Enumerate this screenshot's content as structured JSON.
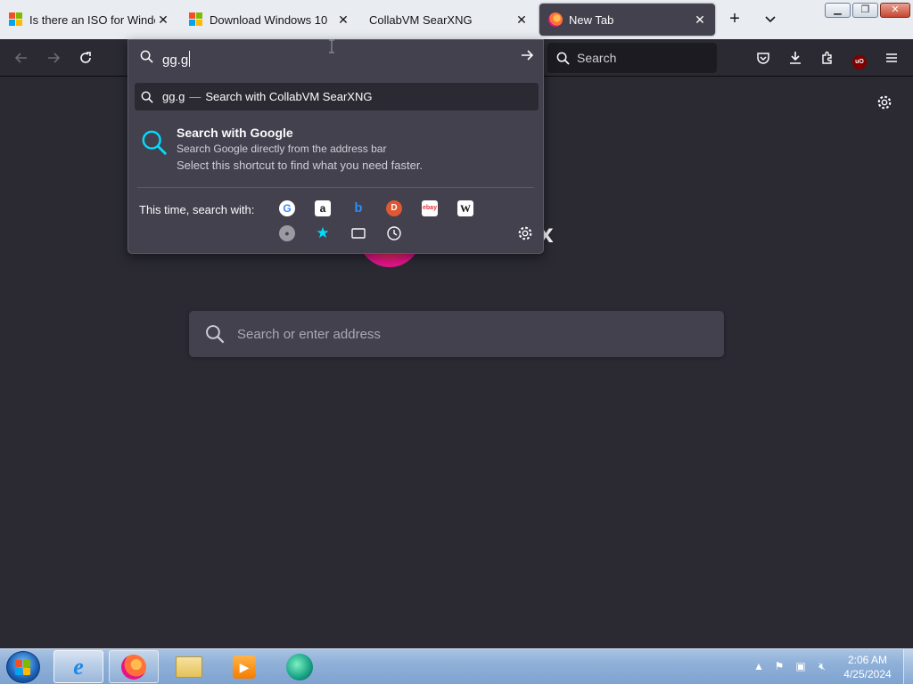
{
  "tabs": [
    {
      "title": "Is there an ISO for Windows",
      "icon": "windows-logo-icon",
      "active": false
    },
    {
      "title": "Download Windows 10",
      "icon": "windows-logo-icon",
      "active": false
    },
    {
      "title": "CollabVM SearXNG",
      "icon": "",
      "active": false
    },
    {
      "title": "New Tab",
      "icon": "firefox-logo-icon",
      "active": true
    }
  ],
  "toolbar": {
    "search_placeholder": "Search"
  },
  "urlbar": {
    "value": "gg.g",
    "suggestion_query": "gg.g",
    "suggestion_separator": "—",
    "suggestion_action": "Search with CollabVM SearXNG",
    "tip_title": "Search with Google",
    "tip_subtitle": "Search Google directly from the address bar",
    "tip_action": "Select this shortcut to find what you need faster.",
    "oneoff_label": "This time, search with:",
    "engines": [
      "google",
      "amazon",
      "bing",
      "duckduckgo",
      "ebay",
      "wikipedia",
      "searxng",
      "bookmarks",
      "tabs",
      "history"
    ]
  },
  "page": {
    "wordmark_visible_letter": "x",
    "search_placeholder": "Search or enter address"
  },
  "taskbar": {
    "clock_time": "2:06 AM",
    "clock_date": "4/25/2024",
    "apps": [
      "internet-explorer",
      "firefox",
      "file-explorer",
      "media-player",
      "app-green"
    ]
  },
  "colors": {
    "page_bg": "#2b2a33",
    "panel_bg": "#42414d",
    "accent_cyan": "#00ddff"
  }
}
